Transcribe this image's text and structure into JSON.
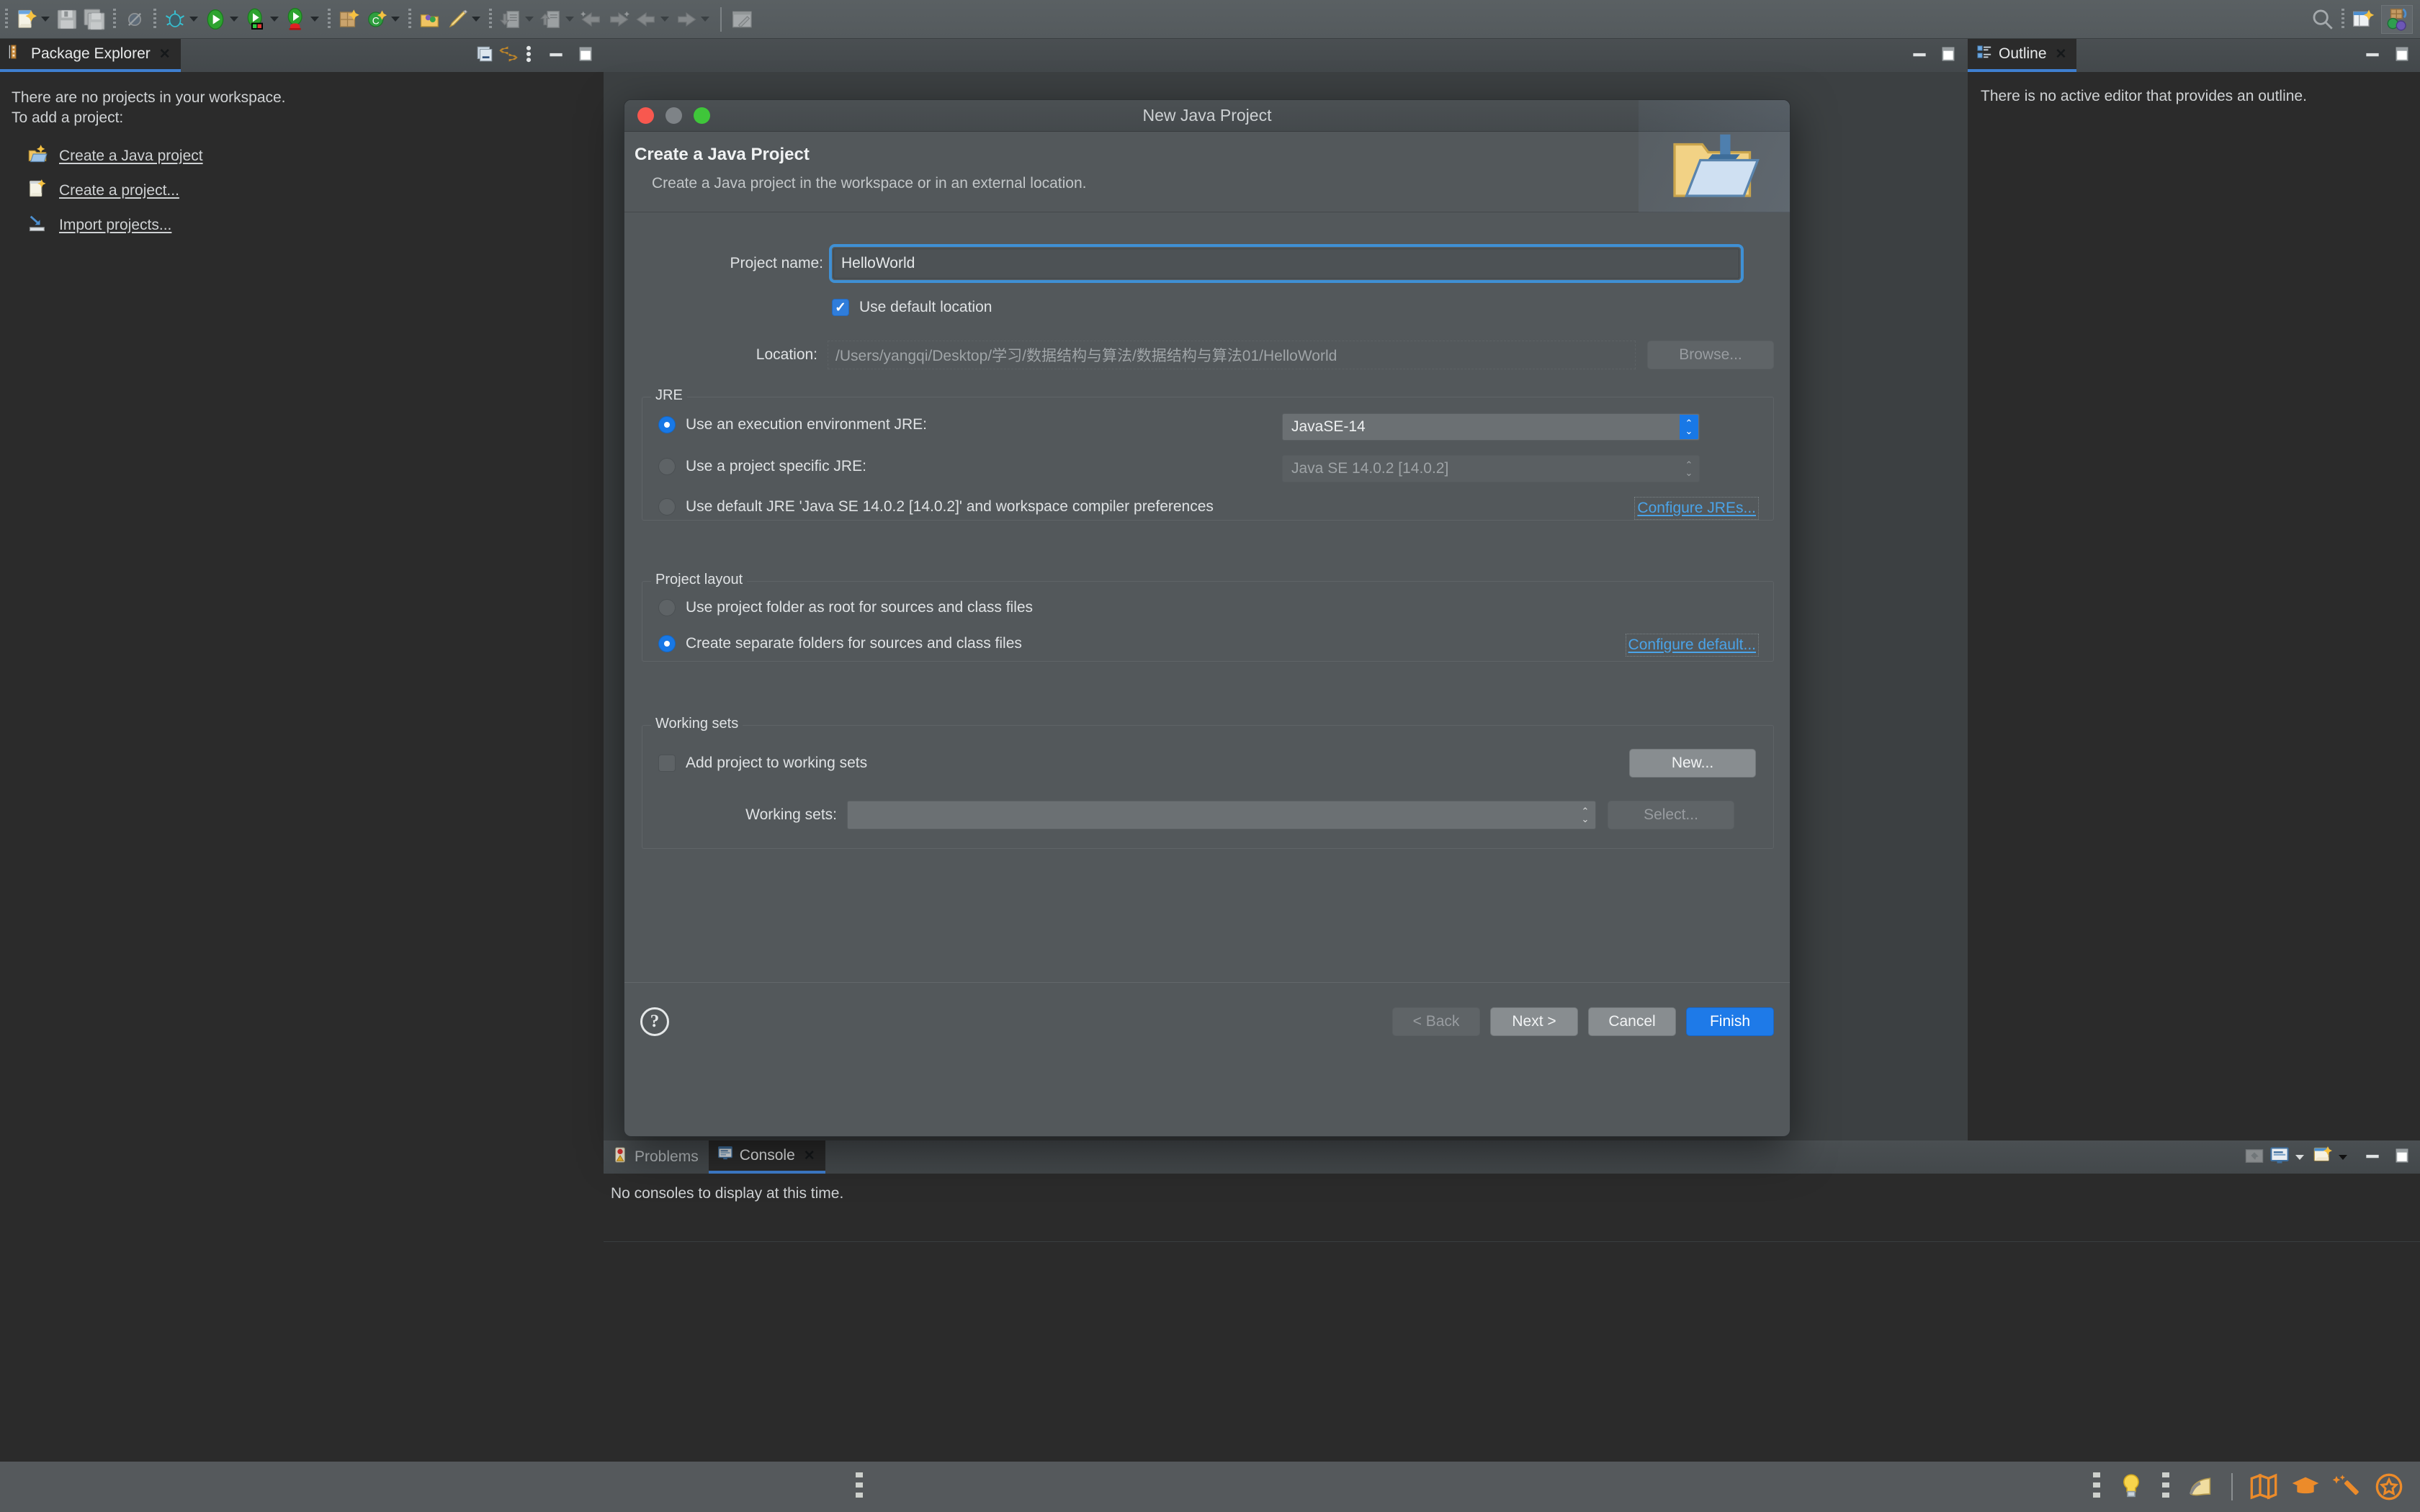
{
  "app": {
    "title": "Eclipse IDE",
    "theme_bg": "#2b2b2b",
    "accent": "#1878e6",
    "link_color": "#4aa3e8"
  },
  "toolbar": {
    "items": [
      {
        "name": "new-wizard-icon",
        "label": "New"
      },
      {
        "name": "save-icon",
        "label": "Save"
      },
      {
        "name": "save-all-icon",
        "label": "Save All"
      },
      {
        "name": "skip-breakpoints-icon",
        "label": "Skip All Breakpoints"
      },
      {
        "name": "debug-icon",
        "label": "Debug"
      },
      {
        "name": "run-icon",
        "label": "Run"
      },
      {
        "name": "coverage-icon",
        "label": "Coverage"
      },
      {
        "name": "run-ant-icon",
        "label": "External Tools"
      },
      {
        "name": "new-java-package-icon",
        "label": "New Java Package"
      },
      {
        "name": "new-class-icon",
        "label": "New Java Class"
      },
      {
        "name": "open-type-icon",
        "label": "Open Type"
      },
      {
        "name": "open-task-icon",
        "label": "Open Task"
      },
      {
        "name": "import-icon",
        "label": "Import"
      },
      {
        "name": "export-icon",
        "label": "Export"
      },
      {
        "name": "prev-annotation-icon",
        "label": "Previous Annotation"
      },
      {
        "name": "next-annotation-icon",
        "label": "Next Annotation"
      },
      {
        "name": "back-icon",
        "label": "Back"
      },
      {
        "name": "forward-icon",
        "label": "Forward"
      },
      {
        "name": "new-editor-icon",
        "label": "New Editor"
      }
    ],
    "right": [
      {
        "name": "search-icon",
        "label": "Search"
      },
      {
        "name": "quick-access-icon",
        "label": "Quick Access"
      },
      {
        "name": "open-perspective-icon",
        "label": "Open Perspective"
      },
      {
        "name": "java-perspective-icon",
        "label": "Java"
      }
    ]
  },
  "package_explorer": {
    "tab_label": "Package Explorer",
    "icon": "package-explorer-icon",
    "empty_line1": "There are no projects in your workspace.",
    "empty_line2": "To add a project:",
    "links": [
      {
        "label": "Create a Java project",
        "icon": "new-java-project-icon",
        "name": "create-java-project-link"
      },
      {
        "label": "Create a project...",
        "icon": "new-project-icon",
        "name": "create-project-link"
      },
      {
        "label": "Import projects...",
        "icon": "import-projects-icon",
        "name": "import-projects-link"
      }
    ],
    "tools": [
      {
        "name": "collapse-all-icon",
        "label": "Collapse All"
      },
      {
        "name": "link-with-editor-icon",
        "label": "Link with Editor"
      },
      {
        "name": "view-menu-icon",
        "label": "View Menu"
      },
      {
        "name": "minimize-icon",
        "label": "Minimize"
      },
      {
        "name": "maximize-icon",
        "label": "Maximize"
      }
    ]
  },
  "editor_area": {
    "tools": [
      {
        "name": "minimize-icon",
        "label": "Minimize"
      },
      {
        "name": "maximize-icon",
        "label": "Maximize"
      }
    ]
  },
  "outline": {
    "tab_label": "Outline",
    "icon": "outline-icon",
    "empty_text": "There is no active editor that provides an outline.",
    "tools": [
      {
        "name": "minimize-icon",
        "label": "Minimize"
      },
      {
        "name": "maximize-icon",
        "label": "Maximize"
      }
    ]
  },
  "bottom_panel": {
    "tabs": [
      {
        "label": "Problems",
        "icon": "problems-icon",
        "active": false,
        "closable": false
      },
      {
        "label": "Console",
        "icon": "console-icon",
        "active": true,
        "closable": true
      }
    ],
    "console_empty_text": "No consoles to display at this time.",
    "tools": [
      {
        "name": "pin-console-icon",
        "label": "Pin Console"
      },
      {
        "name": "display-selected-console-icon",
        "label": "Display Selected Console"
      },
      {
        "name": "open-console-icon",
        "label": "Open Console"
      },
      {
        "name": "minimize-icon",
        "label": "Minimize"
      },
      {
        "name": "maximize-icon",
        "label": "Maximize"
      }
    ]
  },
  "status_bar": {
    "items": [
      {
        "name": "smart-insert-icon",
        "label": "Tip of the Day"
      },
      {
        "name": "writable-icon",
        "label": "Writable"
      },
      {
        "name": "map-icon",
        "label": "Map"
      },
      {
        "name": "tutorial-icon",
        "label": "Tutorials"
      },
      {
        "name": "magic-wand-icon",
        "label": "Quick Fix"
      },
      {
        "name": "star-icon",
        "label": "Favorites"
      }
    ]
  },
  "dialog": {
    "window_title": "New Java Project",
    "traffic_lights": {
      "close": "#f8584f",
      "minimize": "#7e8387",
      "zoom": "#3fc63a"
    },
    "header": {
      "title": "Create a Java Project",
      "subtitle": "Create a Java project in the workspace or in an external location.",
      "icon": "new-java-project-banner-icon"
    },
    "project_name": {
      "label": "Project name:",
      "value": "HelloWorld",
      "placeholder": ""
    },
    "use_default_location": {
      "label": "Use default location",
      "checked": true
    },
    "location": {
      "label": "Location:",
      "value": "/Users/yangqi/Desktop/学习/数据结构与算法/数据结构与算法01/HelloWorld",
      "browse_label": "Browse...",
      "browse_enabled": false
    },
    "jre": {
      "group_title": "JRE",
      "options": [
        {
          "label": "Use an execution environment JRE:",
          "selected": true,
          "name": "jre-execution-environment-radio"
        },
        {
          "label": "Use a project specific JRE:",
          "selected": false,
          "name": "jre-project-specific-radio"
        },
        {
          "label": "Use default JRE 'Java SE 14.0.2 [14.0.2]' and workspace compiler preferences",
          "selected": false,
          "name": "jre-default-radio"
        }
      ],
      "execution_env_value": "JavaSE-14",
      "project_specific_value": "Java SE 14.0.2 [14.0.2]",
      "configure_link": "Configure JREs..."
    },
    "project_layout": {
      "group_title": "Project layout",
      "options": [
        {
          "label": "Use project folder as root for sources and class files",
          "selected": false,
          "name": "layout-project-folder-radio"
        },
        {
          "label": "Create separate folders for sources and class files",
          "selected": true,
          "name": "layout-separate-folders-radio"
        }
      ],
      "configure_link": "Configure default..."
    },
    "working_sets": {
      "group_title": "Working sets",
      "add_checkbox_label": "Add project to working sets",
      "add_checked": false,
      "new_button": "New...",
      "working_sets_label": "Working sets:",
      "working_sets_value": "",
      "select_button": "Select...",
      "select_enabled": false
    },
    "footer": {
      "help_label": "?",
      "back": {
        "label": "< Back",
        "enabled": false
      },
      "next": {
        "label": "Next >",
        "enabled": true
      },
      "cancel": {
        "label": "Cancel",
        "enabled": true
      },
      "finish": {
        "label": "Finish",
        "enabled": true,
        "primary": true
      }
    }
  }
}
